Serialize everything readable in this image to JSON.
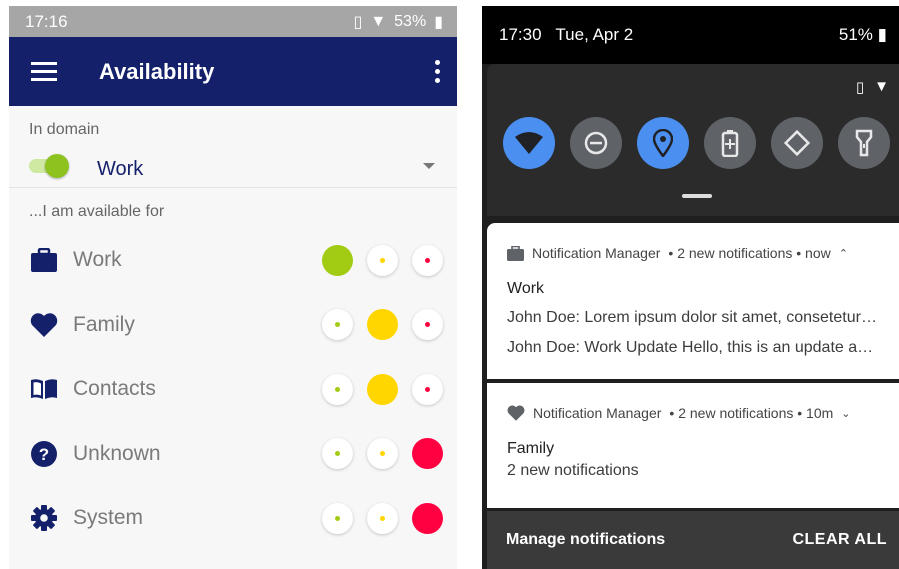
{
  "left": {
    "status": {
      "time": "17:16",
      "battery": "53%"
    },
    "appbar": {
      "title": "Availability"
    },
    "domain": {
      "label": "In domain",
      "value": "Work",
      "enabled": true
    },
    "available_label": "...I am available for",
    "categories": [
      {
        "label": "Work",
        "icon": "briefcase-icon",
        "selected": 0
      },
      {
        "label": "Family",
        "icon": "heart-icon",
        "selected": 1
      },
      {
        "label": "Contacts",
        "icon": "book-icon",
        "selected": 1
      },
      {
        "label": "Unknown",
        "icon": "help-icon",
        "selected": 2
      },
      {
        "label": "System",
        "icon": "gear-icon",
        "selected": 2
      }
    ],
    "level_colors": [
      "#a2cc14",
      "#ffd600",
      "#ff0040"
    ]
  },
  "right": {
    "status": {
      "time": "17:30",
      "date": "Tue, Apr 2",
      "battery": "51%"
    },
    "quick_settings": [
      "wifi-icon",
      "do-not-disturb-icon",
      "location-icon",
      "battery-saver-icon",
      "auto-rotate-icon",
      "flashlight-icon"
    ],
    "notifications": [
      {
        "app": "Notification Manager",
        "meta": "• 2 new notifications • now",
        "title": "Work",
        "lines": [
          "John Doe: Lorem ipsum dolor sit amet, consetetur…",
          "John Doe: Work Update   Hello, this is an update a…"
        ]
      },
      {
        "app": "Notification Manager",
        "meta": "• 2 new notifications • 10m",
        "title": "Family",
        "lines": [
          "2 new notifications"
        ]
      }
    ],
    "footer": {
      "manage": "Manage notifications",
      "clear": "CLEAR ALL"
    }
  }
}
